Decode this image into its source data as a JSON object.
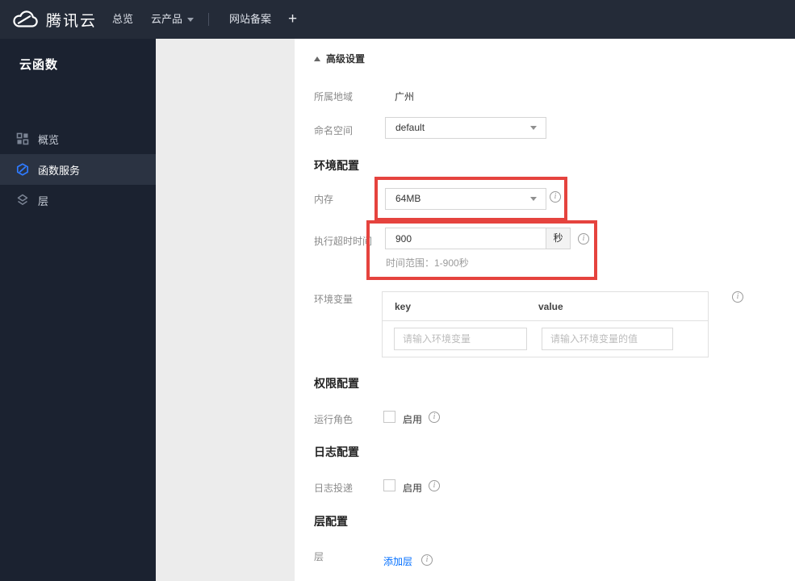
{
  "topnav": {
    "brand": "腾讯云",
    "overview": "总览",
    "products": "云产品",
    "icp": "网站备案",
    "plus": "+"
  },
  "sidebar": {
    "title": "云函数",
    "items": [
      {
        "label": "概览",
        "icon": "grid-icon"
      },
      {
        "label": "函数服务",
        "icon": "function-icon"
      },
      {
        "label": "层",
        "icon": "layers-icon"
      }
    ]
  },
  "content": {
    "advanced_toggle": "高级设置",
    "region_label": "所属地域",
    "region_value": "广州",
    "namespace_label": "命名空间",
    "namespace_value": "default",
    "env_section_title": "环境配置",
    "memory_label": "内存",
    "memory_value": "64MB",
    "timeout_label": "执行超时时间",
    "timeout_value": "900",
    "timeout_unit": "秒",
    "timeout_hint": "时间范围：1-900秒",
    "envvar_label": "环境变量",
    "envvar_key_header": "key",
    "envvar_value_header": "value",
    "envvar_key_placeholder": "请输入环境变量",
    "envvar_value_placeholder": "请输入环境变量的值",
    "perm_section_title": "权限配置",
    "role_label": "运行角色",
    "role_enable_label": "启用",
    "log_section_title": "日志配置",
    "log_label": "日志投递",
    "log_enable_label": "启用",
    "layer_section_title": "层配置",
    "layer_label": "层",
    "layer_add_link": "添加层"
  },
  "colors": {
    "navbar_bg": "#242b38",
    "sidebar_bg": "#1b2230",
    "sidebar_active_bg": "#2b3342",
    "accent_blue": "#006eff",
    "annotation_red": "#e5433e"
  }
}
